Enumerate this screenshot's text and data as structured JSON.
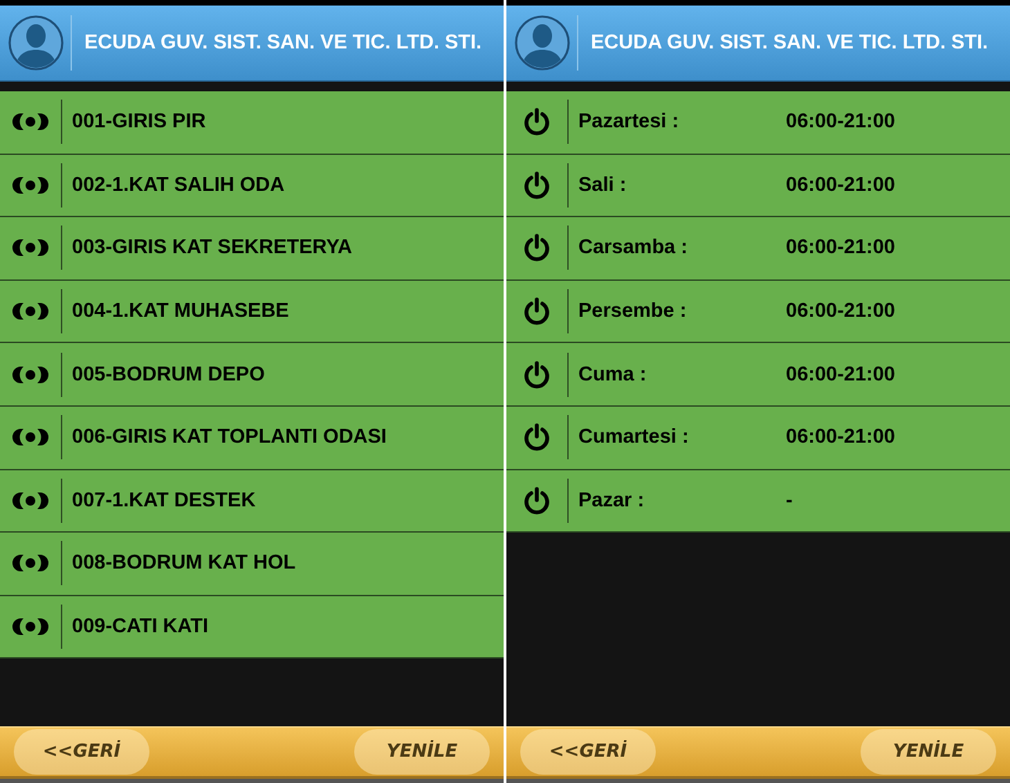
{
  "screens": [
    {
      "kind": "zones",
      "header": {
        "title": "ECUDA GUV. SIST. SAN. VE TIC. LTD. STI."
      },
      "rows": [
        {
          "label": "001-GIRIS PIR"
        },
        {
          "label": "002-1.KAT SALIH ODA"
        },
        {
          "label": "003-GIRIS KAT SEKRETERYA"
        },
        {
          "label": "004-1.KAT MUHASEBE"
        },
        {
          "label": "005-BODRUM DEPO"
        },
        {
          "label": "006-GIRIS KAT TOPLANTI ODASI"
        },
        {
          "label": "007-1.KAT DESTEK"
        },
        {
          "label": "008-BODRUM KAT HOL"
        },
        {
          "label": "009-CATI KATI"
        }
      ],
      "footer": {
        "back": "<<GERİ",
        "refresh": "YENİLE"
      }
    },
    {
      "kind": "schedule",
      "header": {
        "title": "ECUDA GUV. SIST. SAN. VE TIC. LTD. STI."
      },
      "rows": [
        {
          "day": "Pazartesi :",
          "hours": "06:00-21:00"
        },
        {
          "day": "Sali :",
          "hours": "06:00-21:00"
        },
        {
          "day": "Carsamba :",
          "hours": "06:00-21:00"
        },
        {
          "day": "Persembe :",
          "hours": "06:00-21:00"
        },
        {
          "day": "Cuma :",
          "hours": "06:00-21:00"
        },
        {
          "day": "Cumartesi :",
          "hours": "06:00-21:00"
        },
        {
          "day": "Pazar :",
          "hours": "-"
        }
      ],
      "footer": {
        "back": "<<GERİ",
        "refresh": "YENİLE"
      }
    }
  ]
}
